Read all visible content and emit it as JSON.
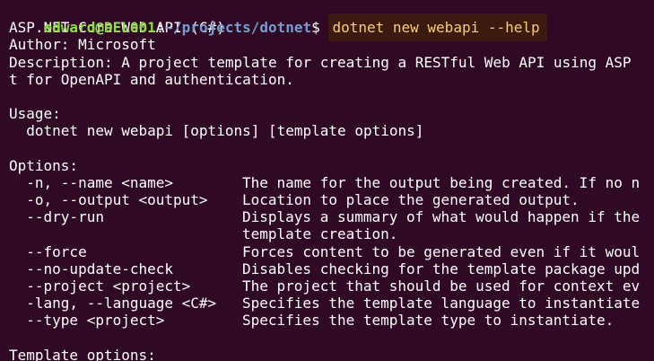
{
  "prompt": {
    "top_partial": "ed4ard@DEL001:~/projects/dotnet$",
    "user_host": "edward@DEL001",
    "colon": ":",
    "path": "~/projects/dotnet",
    "dollar": "$",
    "command": "dotnet new webapi --help"
  },
  "header": {
    "title": "ASP.NET Core Web API (C#)",
    "author": "Author: Microsoft",
    "description_line1": "Description: A project template for creating a RESTful Web API using ASP",
    "description_line2": "t for OpenAPI and authentication."
  },
  "usage": {
    "heading": "Usage:",
    "line": "  dotnet new webapi [options] [template options]"
  },
  "options": {
    "heading": "Options:",
    "items": [
      {
        "name": "  -n, --name <name>",
        "desc": "The name for the output being created. If no n"
      },
      {
        "name": "  -o, --output <output>",
        "desc": "Location to place the generated output."
      },
      {
        "name": "  --dry-run",
        "desc": "Displays a summary of what would happen if the"
      },
      {
        "name": "",
        "desc": "template creation."
      },
      {
        "name": "  --force",
        "desc": "Forces content to be generated even if it woul"
      },
      {
        "name": "  --no-update-check",
        "desc": "Disables checking for the template package upd"
      },
      {
        "name": "  --project <project>",
        "desc": "The project that should be used for context ev"
      },
      {
        "name": "  -lang, --language <C#>",
        "desc": "Specifies the template language to instantiate"
      },
      {
        "name": "  --type <project>",
        "desc": "Specifies the template type to instantiate."
      }
    ]
  },
  "template_options": {
    "heading": "Template options:"
  },
  "colors": {
    "background": "#300a24",
    "user_host": "#8ae234",
    "path": "#729fcf",
    "command_text": "#f4d06f",
    "command_bg": "#3d1a10"
  }
}
